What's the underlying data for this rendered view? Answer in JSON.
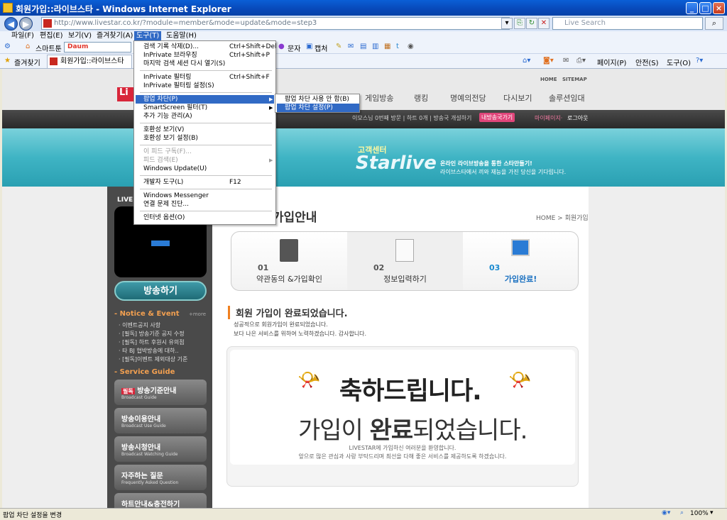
{
  "window": {
    "title": "회원가입::라이브스타 - Windows Internet Explorer"
  },
  "address": {
    "url": "http://www.livestar.co.kr/?module=member&mode=update&mode=step3",
    "search_placeholder": "Live Search"
  },
  "menubar": [
    "파일(F)",
    "편집(E)",
    "보기(V)",
    "즐겨찾기(A)",
    "도구(T)",
    "도움말(H)"
  ],
  "toolbar": {
    "smarttoon": "스마트툰",
    "daum": "Daum",
    "munja": "문자",
    "capture": "캡처"
  },
  "favbar": {
    "favorites": "즐겨찾기",
    "tab": "회원가입::라이브스타"
  },
  "commandbar": {
    "page": "페이지(P)",
    "safety": "안전(S)",
    "tools": "도구(O)"
  },
  "tools_menu": {
    "items": [
      {
        "label": "검색 기록 삭제(D)...",
        "shortcut": "Ctrl+Shift+Del"
      },
      {
        "label": "InPrivate 브라우징",
        "shortcut": "Ctrl+Shift+P"
      },
      {
        "label": "마지막 검색 세션 다시 열기(S)",
        "shortcut": ""
      },
      {
        "label": "InPrivate 필터링",
        "shortcut": "Ctrl+Shift+F"
      },
      {
        "label": "InPrivate 필터링 설정(S)",
        "shortcut": ""
      },
      {
        "label": "팝업 차단(P)",
        "shortcut": ""
      },
      {
        "label": "SmartScreen 필터(T)",
        "shortcut": ""
      },
      {
        "label": "추가 기능 관리(A)",
        "shortcut": ""
      },
      {
        "label": "호환성 보기(V)",
        "shortcut": ""
      },
      {
        "label": "호환성 보기 설정(B)",
        "shortcut": ""
      },
      {
        "label": "이 피드 구독(F)...",
        "shortcut": ""
      },
      {
        "label": "피드 검색(E)",
        "shortcut": ""
      },
      {
        "label": "Windows Update(U)",
        "shortcut": ""
      },
      {
        "label": "개발자 도구(L)",
        "shortcut": "F12"
      },
      {
        "label": "Windows Messenger",
        "shortcut": ""
      },
      {
        "label": "연결 문제 진단...",
        "shortcut": ""
      },
      {
        "label": "인터넷 옵션(O)",
        "shortcut": ""
      }
    ],
    "submenu": [
      "팝업 차단 사용 안 함(B)",
      "팝업 차단 설정(P)"
    ]
  },
  "site": {
    "util": [
      "HOME",
      "SITEMAP"
    ],
    "nav": [
      "게임방송",
      "랭킹",
      "명예의전당",
      "다시보기",
      "솔루션임대"
    ],
    "userbar": "이모스님 0번째 방문 | 하트 0개 | 방송국 개설하기",
    "mybroadcast": "내방송국가기",
    "mypage": "마이페이지·",
    "logout": "로그아웃",
    "banner_small": "고객센터",
    "banner_big": "Starlive",
    "banner_line1": "온라인 라이브방송을 통한 스타만들기!",
    "banner_line2": "라이브스타에서 끼와 재능을 가진 당신을 기다립니다.",
    "live_label": "LIVE",
    "broadcast_btn": "방송하기",
    "notice_head": "- Notice & Event",
    "more": "+more",
    "notices": [
      "· 이벤트공지 사항",
      "· [필독] 방송기준 공지 수정",
      "· [필독] 하트 후원시 유의점",
      "· 타 BJ 협박방송에 대하..",
      "· [필독]이벤트 제외대상 기준"
    ],
    "guide_head": "- Service Guide",
    "guides": [
      {
        "title": "방송기준안내",
        "sub": "Broadcast Guide",
        "badge": "필독"
      },
      {
        "title": "방송이용안내",
        "sub": "Broadcast Use Guide",
        "badge": ""
      },
      {
        "title": "방송시청안내",
        "sub": "Broadcast Watching Guide",
        "badge": ""
      },
      {
        "title": "자주하는 질문",
        "sub": "Frequently Asked Question",
        "badge": ""
      },
      {
        "title": "하트안내&충전하기",
        "sub": "",
        "badge": ""
      }
    ],
    "page_title": "&가입안내",
    "breadcrumb": "HOME > 회원가입",
    "steps": [
      {
        "num": "01",
        "label": "약관동의 &가입확인"
      },
      {
        "num": "02",
        "label": "정보입력하기"
      },
      {
        "num": "03",
        "label": "가입완료!"
      }
    ],
    "done_title": "회원 가입이 완료되었습니다.",
    "done_line1": "성공적으로 회원가입이 완료되었습니다.",
    "done_line2": "보다 나은 서비스를 위하여 노력하겠습니다. 감사합니다.",
    "congrats": "축하드립니다.",
    "signup_a": "가입이 ",
    "signup_b": "완료",
    "signup_c": "되었습니다.",
    "welcome1": "LIVESTAR에 가입하신 여러분을 환영합니다.",
    "welcome2": "앞으로 많은 관심과 사랑 부탁드리며 최선을 다해 좋은 서비스를 제공하도록 하겠습니다."
  },
  "status": {
    "text": "팝업 차단 설정을 변경",
    "zoom": "100%"
  }
}
